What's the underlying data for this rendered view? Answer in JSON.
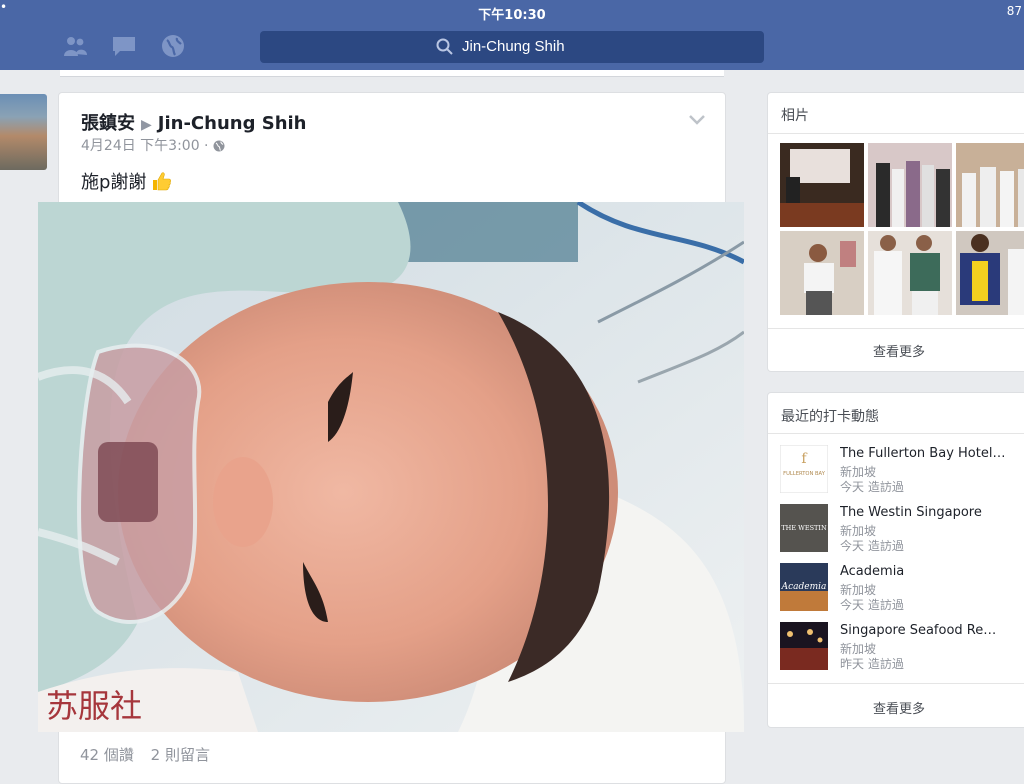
{
  "status": {
    "time": "下午10:30",
    "battery": "87",
    "signal": "•"
  },
  "search": {
    "query": "Jin-Chung Shih"
  },
  "post": {
    "author": "張鎮安",
    "target": "Jin-Chung Shih",
    "date": "4月24日 下午3:00 ·",
    "text": "施p謝謝",
    "likes": "42 個讚",
    "comments": "2 則留言"
  },
  "photos_panel": {
    "title": "相片",
    "see_more": "查看更多"
  },
  "checkins_panel": {
    "title": "最近的打卡動態",
    "see_more": "查看更多",
    "items": [
      {
        "name": "The Fullerton Bay Hotel…",
        "location": "新加坡",
        "visited": "今天 造訪過",
        "logo_text": "FULLERTON BAY"
      },
      {
        "name": "The Westin Singapore",
        "location": "新加坡",
        "visited": "今天 造訪過",
        "logo_text": "THE WESTIN"
      },
      {
        "name": "Academia",
        "location": "新加坡",
        "visited": "今天 造訪過",
        "logo_text": "Academia"
      },
      {
        "name": "Singapore Seafood Re…",
        "location": "新加坡",
        "visited": "昨天 造訪過",
        "logo_text": ""
      }
    ]
  },
  "colors": {
    "topbar": "#4a67a6",
    "search_bg": "#2c4882",
    "page_bg": "#e9ebee"
  }
}
